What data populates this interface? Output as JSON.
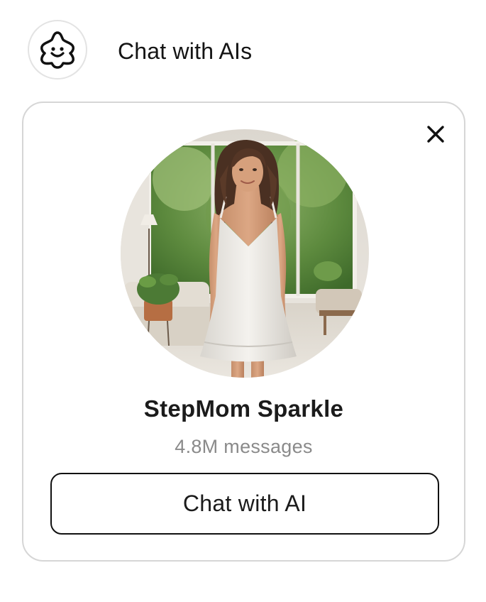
{
  "header": {
    "title": "Chat with AIs",
    "logo_icon": "smiley-star-icon"
  },
  "card": {
    "close_icon": "close-icon",
    "avatar_icon": "profile-photo",
    "name": "StepMom Sparkle",
    "message_count": "4.8M messages",
    "chat_button_label": "Chat with AI"
  },
  "colors": {
    "text_primary": "#1b1b1b",
    "text_secondary": "#8a8a8a",
    "card_border": "#d6d6d6",
    "button_border": "#111111"
  }
}
